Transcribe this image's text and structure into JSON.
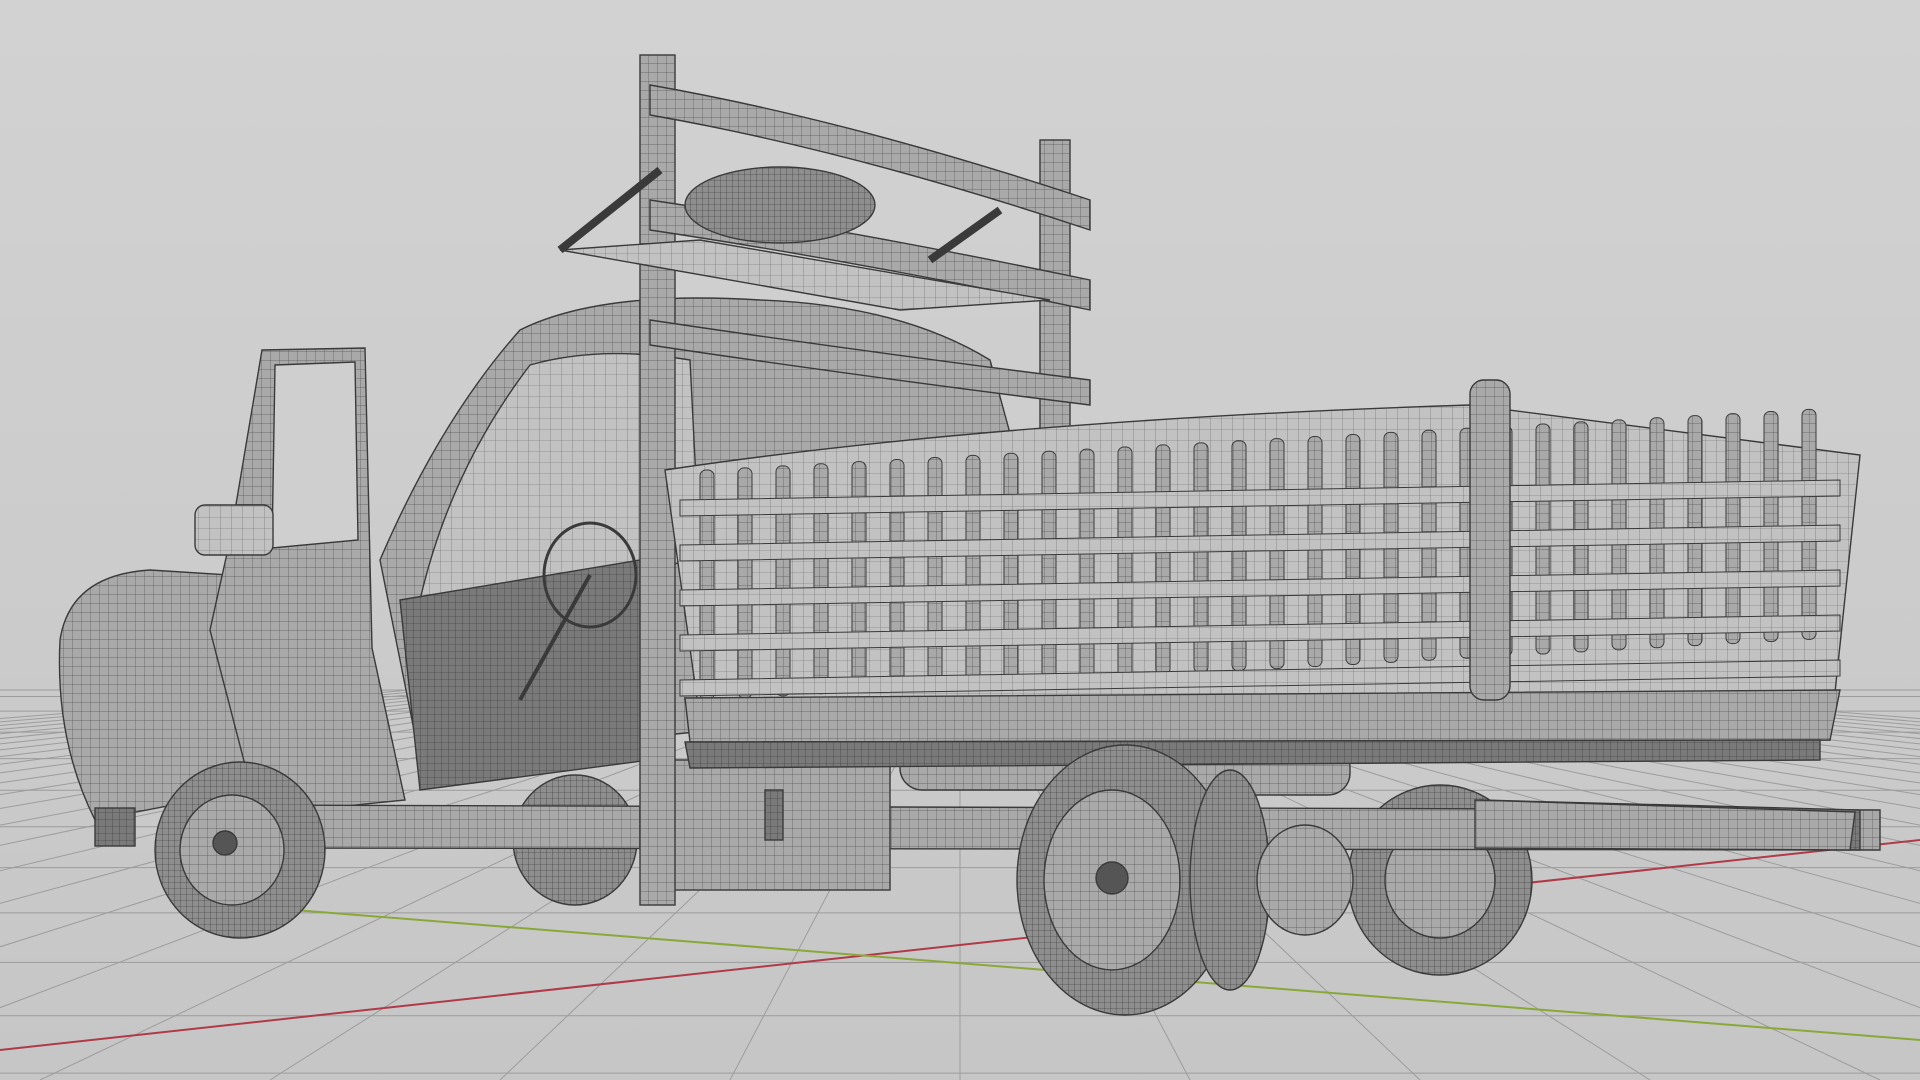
{
  "viewport": {
    "view_type": "3d-perspective-wireframe-shaded",
    "subject": "pickup-truck-with-woven-cargo-bed",
    "colors": {
      "background": "#cfcfcf",
      "grid_line": "#9c9c9c",
      "x_axis": "#b03a48",
      "y_axis": "#8aa83a",
      "mesh_fill": "#a7a7a7",
      "mesh_fill_light": "#bdbdbd",
      "wire": "#3a3a3a"
    },
    "grid_visible": true,
    "axes_visible": [
      "x",
      "y"
    ]
  }
}
